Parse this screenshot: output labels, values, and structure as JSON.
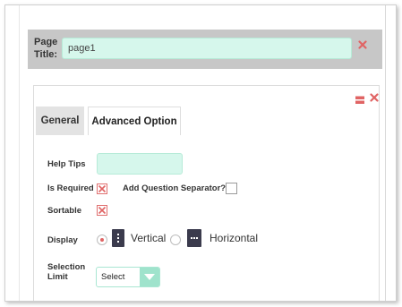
{
  "header": {
    "title_label_line1": "Page",
    "title_label_line2": "Title:",
    "title_value": "page1"
  },
  "tabs": [
    {
      "label": "General",
      "active": false
    },
    {
      "label": "Advanced Option",
      "active": true
    }
  ],
  "form": {
    "help_tips_label": "Help Tips",
    "help_tips_value": "",
    "is_required_label": "Is Required",
    "is_required_checked": true,
    "add_separator_label": "Add Question Separator?",
    "add_separator_checked": false,
    "sortable_label": "Sortable",
    "sortable_checked": true,
    "display_label": "Display",
    "display_options": [
      {
        "label": "Vertical",
        "selected": true,
        "icon": "vertical-layout-icon"
      },
      {
        "label": "Horizontal",
        "selected": false,
        "icon": "horizontal-layout-icon"
      }
    ],
    "selection_limit_label_line1": "Selection",
    "selection_limit_label_line2": "Limit",
    "selection_limit_value": "Select"
  },
  "icons": {
    "close": "close-icon",
    "list": "list-icon",
    "dropdown": "chevron-down-icon"
  },
  "colors": {
    "accent_mint": "#d6f7ec",
    "dropdown_mint": "#9fe3cc",
    "close_red": "#e06464",
    "title_bar_gray": "#c7c7c7"
  }
}
